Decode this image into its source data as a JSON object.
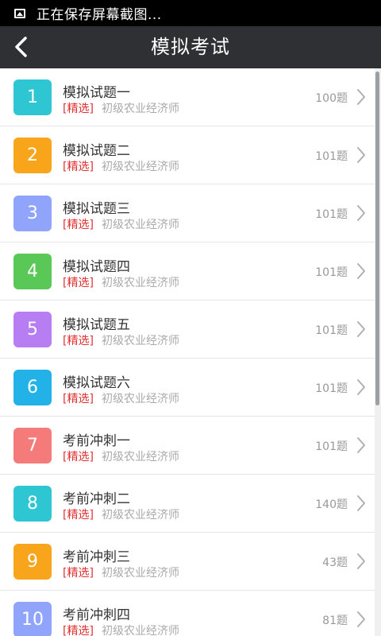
{
  "status_bar": {
    "text": "正在保存屏幕截图..."
  },
  "header": {
    "title": "模拟考试"
  },
  "items": [
    {
      "number": "1",
      "name": "模拟试题一",
      "tag": "[精选]",
      "category": "初级农业经济师",
      "count": "100题",
      "color": "#2ec6d3"
    },
    {
      "number": "2",
      "name": "模拟试题二",
      "tag": "[精选]",
      "category": "初级农业经济师",
      "count": "101题",
      "color": "#f8a51c"
    },
    {
      "number": "3",
      "name": "模拟试题三",
      "tag": "[精选]",
      "category": "初级农业经济师",
      "count": "101题",
      "color": "#8fa4fa"
    },
    {
      "number": "4",
      "name": "模拟试题四",
      "tag": "[精选]",
      "category": "初级农业经济师",
      "count": "101题",
      "color": "#5ac857"
    },
    {
      "number": "5",
      "name": "模拟试题五",
      "tag": "[精选]",
      "category": "初级农业经济师",
      "count": "101题",
      "color": "#b67ef2"
    },
    {
      "number": "6",
      "name": "模拟试题六",
      "tag": "[精选]",
      "category": "初级农业经济师",
      "count": "101题",
      "color": "#22b2e8"
    },
    {
      "number": "7",
      "name": "考前冲刺一",
      "tag": "[精选]",
      "category": "初级农业经济师",
      "count": "101题",
      "color": "#f57a7a"
    },
    {
      "number": "8",
      "name": "考前冲刺二",
      "tag": "[精选]",
      "category": "初级农业经济师",
      "count": "140题",
      "color": "#2ec6d3"
    },
    {
      "number": "9",
      "name": "考前冲刺三",
      "tag": "[精选]",
      "category": "初级农业经济师",
      "count": "43题",
      "color": "#f8a51c"
    },
    {
      "number": "10",
      "name": "考前冲刺四",
      "tag": "[精选]",
      "category": "初级农业经济师",
      "count": "81题",
      "color": "#8fa4fa"
    }
  ]
}
